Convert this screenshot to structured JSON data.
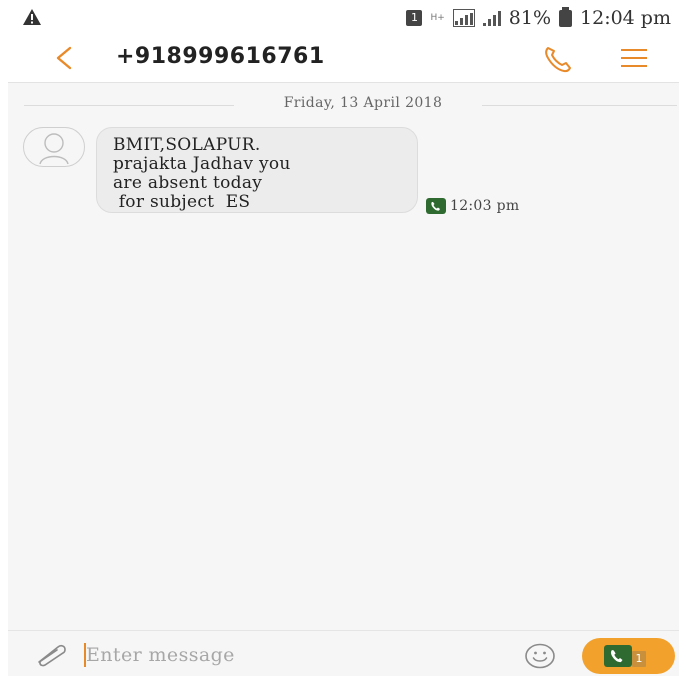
{
  "status_bar": {
    "sim_label": "1",
    "network_type": "H+",
    "battery_percent": "81%",
    "time": "12:04 pm",
    "icons": [
      "warning-icon",
      "sim-icon",
      "network-icon",
      "signal-icon",
      "signal-icon-2",
      "battery-icon"
    ]
  },
  "header": {
    "contact": "+918999616761",
    "icons": [
      "back-icon",
      "call-icon",
      "menu-icon"
    ],
    "accent_color": "#e98a2a"
  },
  "conversation": {
    "date": "Friday, 13 April 2018",
    "messages": [
      {
        "text": "BMIT,SOLAPUR.\nprajakta Jadhav you\nare absent today\n for subject  ES",
        "time": "12:03 pm",
        "sim_icon": "sim-card-icon"
      }
    ]
  },
  "composer": {
    "placeholder": "Enter message",
    "value": "",
    "send_sim_number": "1",
    "icons": [
      "attach-icon",
      "emoji-icon",
      "send-icon"
    ],
    "send_color": "#f2a12c"
  }
}
